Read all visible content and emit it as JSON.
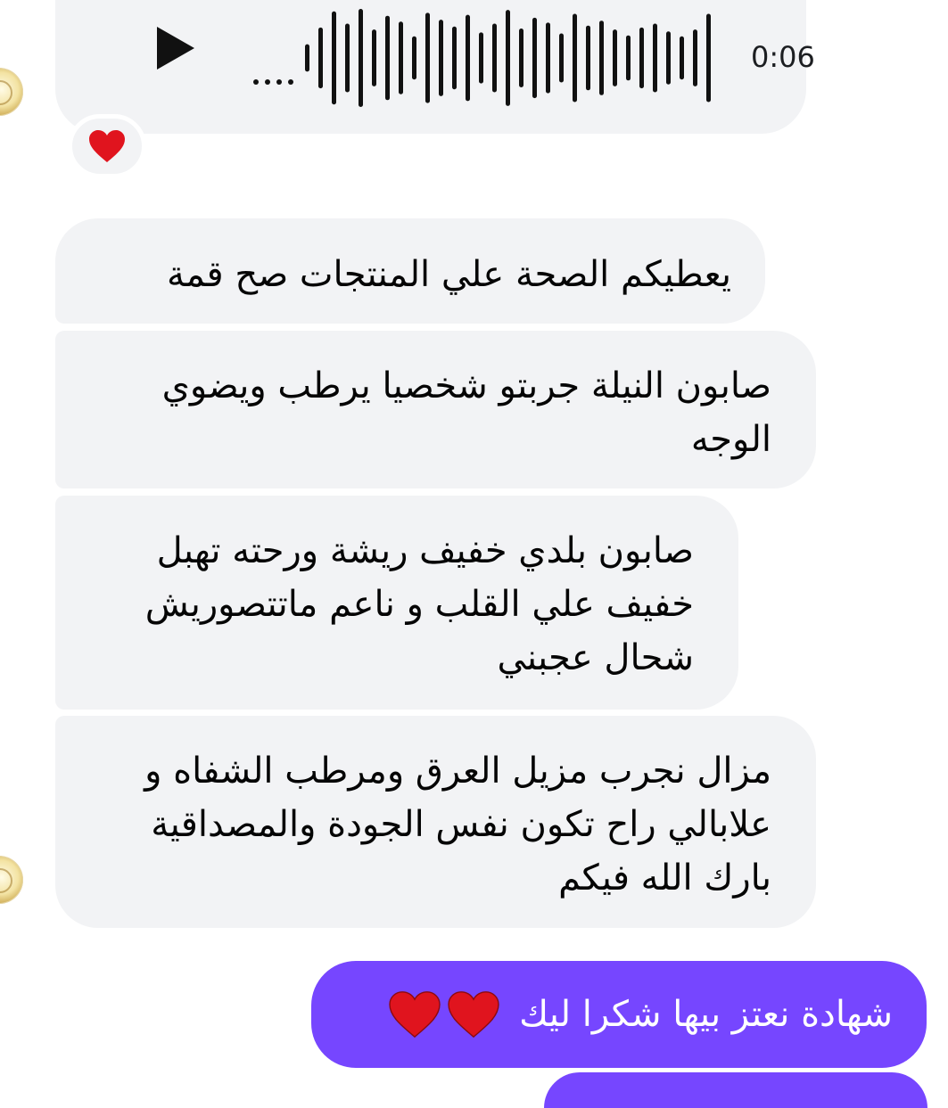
{
  "thread": {
    "audio_message": {
      "duration": "0:06",
      "play_icon": "play-icon",
      "reaction": "red-heart",
      "waveform_levels": [
        0.28,
        0.62,
        0.95,
        0.7,
        1.0,
        0.58,
        0.86,
        0.74,
        0.44,
        0.92,
        0.78,
        0.64,
        0.88,
        0.52,
        0.7,
        0.98,
        0.6,
        0.82,
        0.72,
        0.5,
        0.9,
        0.66,
        0.76,
        0.58,
        0.46,
        0.62,
        0.7,
        0.54,
        0.44,
        0.58,
        0.9
      ]
    },
    "incoming_messages": [
      {
        "lines": [
          "يعطيكم الصحة علي المنتجات صح قمة"
        ]
      },
      {
        "lines": [
          "صابون النيلة جربتو شخصيا يرطب ويضوي",
          "الوجه"
        ]
      },
      {
        "lines": [
          "صابون بلدي خفيف ريشة ورحته تهبل",
          "خفيف علي القلب و ناعم ماتتصوريش",
          "شحال عجبني"
        ]
      },
      {
        "lines": [
          "مزال نجرب مزيل العرق ومرطب الشفاه و",
          "علابالي راح تكون نفس الجودة والمصداقية",
          "بارك الله فيكم"
        ]
      }
    ],
    "outgoing_message": {
      "text": "شهادة نعتز بيها شكرا ليك",
      "emoji": [
        "red-heart",
        "red-heart"
      ]
    }
  },
  "colors": {
    "incoming_bubble": "#f2f3f5",
    "outgoing_bubble": "#7646ff",
    "text_dark": "#050505",
    "heart": "#e0141e"
  }
}
